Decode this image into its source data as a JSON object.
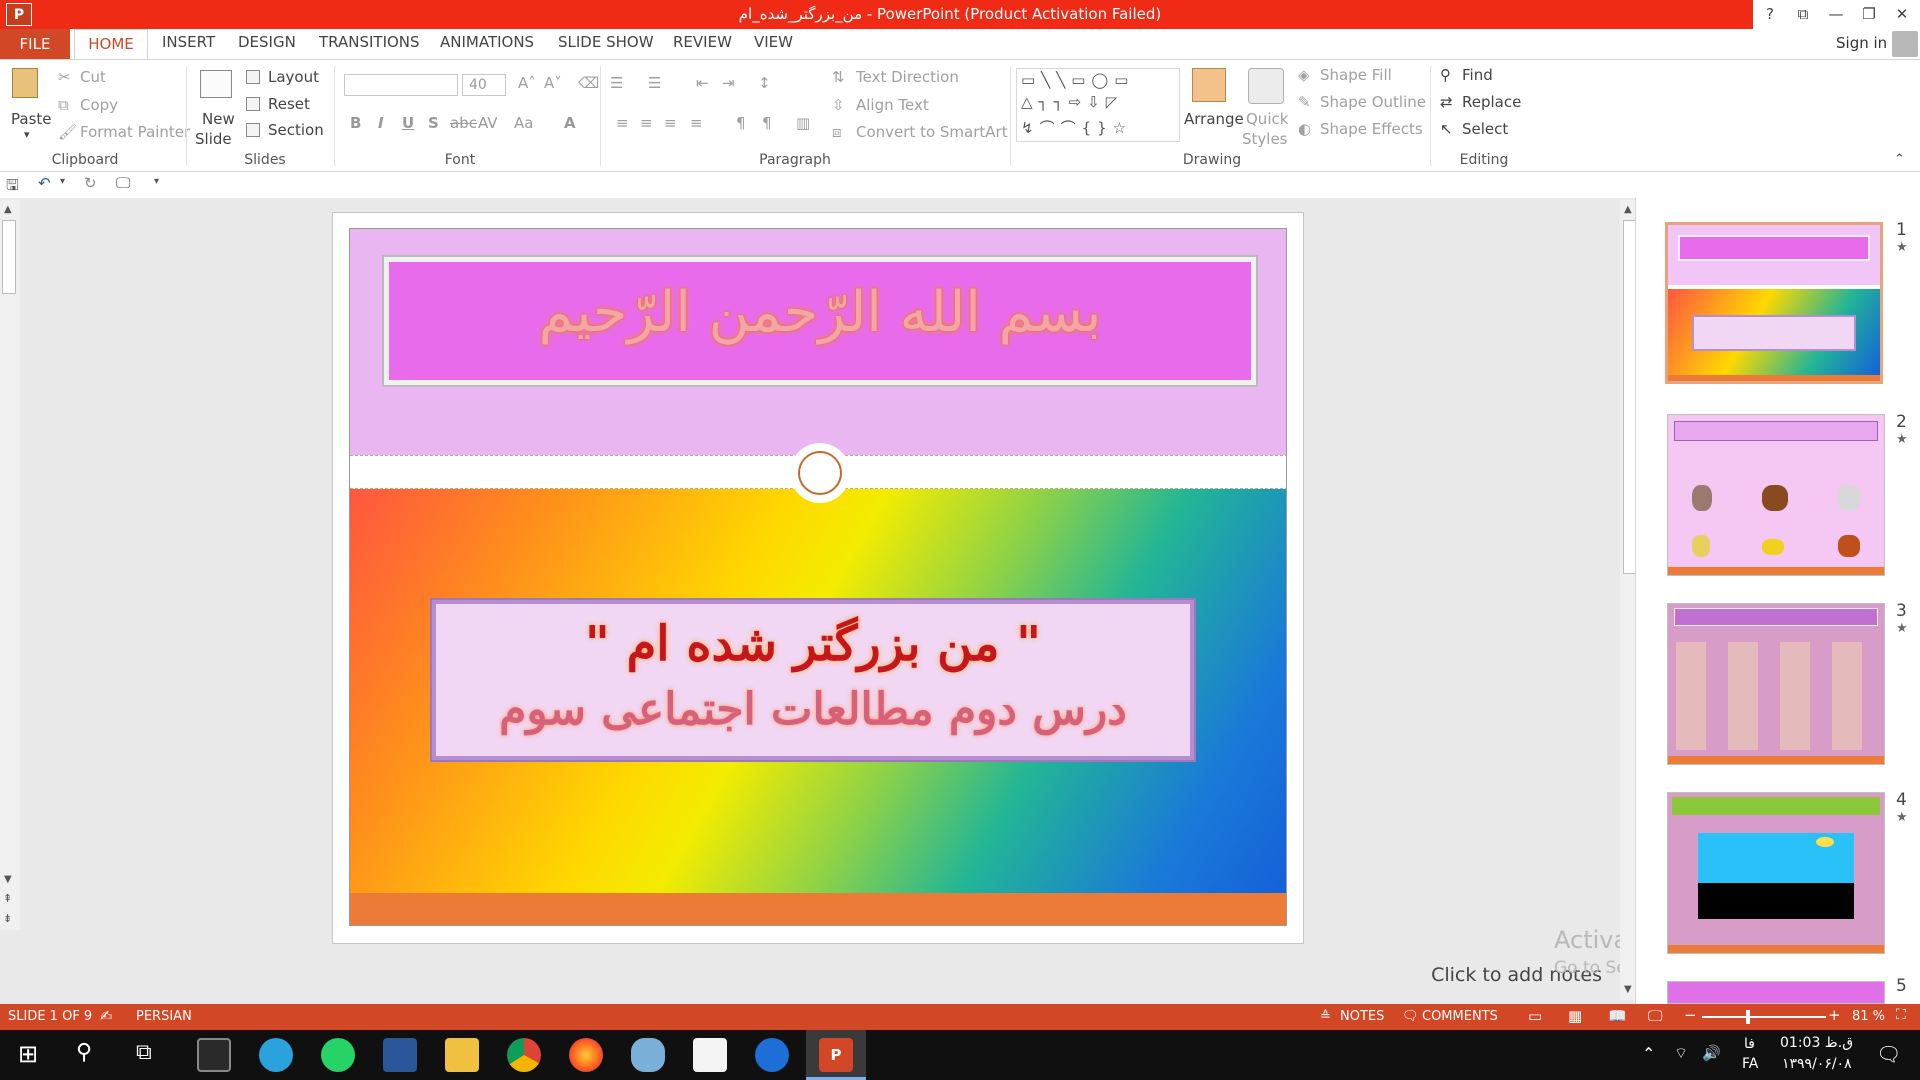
{
  "window": {
    "title": "من_بزرگتر_شده_ام  -  PowerPoint (Product Activation Failed)",
    "app_icon": "P",
    "help": "?",
    "restore_ribbon": "⧉",
    "minimize": "—",
    "maximize": "❐",
    "close": "✕"
  },
  "tabs": [
    "FILE",
    "HOME",
    "INSERT",
    "DESIGN",
    "TRANSITIONS",
    "ANIMATIONS",
    "SLIDE SHOW",
    "REVIEW",
    "VIEW"
  ],
  "signin": "Sign in",
  "ribbon": {
    "clipboard": {
      "paste": "Paste",
      "cut": "Cut",
      "copy": "Copy",
      "format_painter": "Format Painter",
      "label": "Clipboard"
    },
    "slides": {
      "new_slide_1": "New",
      "new_slide_2": "Slide",
      "layout": "Layout",
      "reset": "Reset",
      "section": "Section",
      "label": "Slides"
    },
    "font": {
      "size": "40",
      "label": "Font"
    },
    "paragraph": {
      "text_direction": "Text Direction",
      "align_text": "Align Text",
      "convert_smartart": "Convert to SmartArt",
      "label": "Paragraph"
    },
    "drawing": {
      "arrange": "Arrange",
      "quick_1": "Quick",
      "quick_2": "Styles",
      "shape_fill": "Shape Fill",
      "shape_outline": "Shape Outline",
      "shape_effects": "Shape Effects",
      "label": "Drawing"
    },
    "editing": {
      "find": "Find",
      "replace": "Replace",
      "select": "Select",
      "label": "Editing"
    }
  },
  "slide": {
    "basmala": "بسم الله الرّحمن الرّحیم",
    "line1": "\" من بزرگتر شده ام \"",
    "line2": "درس دوم مطالعات اجتماعی سوم"
  },
  "notes_placeholder": "Click to add notes",
  "watermark": {
    "line1": "Activate Windows",
    "line2": "Go to Settings to activate Windows."
  },
  "thumbnails": [
    {
      "num": "1",
      "star": "★"
    },
    {
      "num": "2",
      "star": "★"
    },
    {
      "num": "3",
      "star": "★"
    },
    {
      "num": "4",
      "star": "★"
    },
    {
      "num": "5",
      "star": ""
    }
  ],
  "status": {
    "slide_count": "SLIDE 1 OF 9",
    "language": "PERSIAN",
    "notes": "NOTES",
    "comments": "COMMENTS",
    "zoom": "81 %"
  },
  "tray": {
    "lang_top": "فا",
    "lang_bottom": "FA",
    "time": "01:03 ق.ظ",
    "date": "۱۳۹۹/۰۶/۰۸"
  },
  "colors": {
    "accent": "#d24726",
    "titlebar": "#ef2b16"
  }
}
